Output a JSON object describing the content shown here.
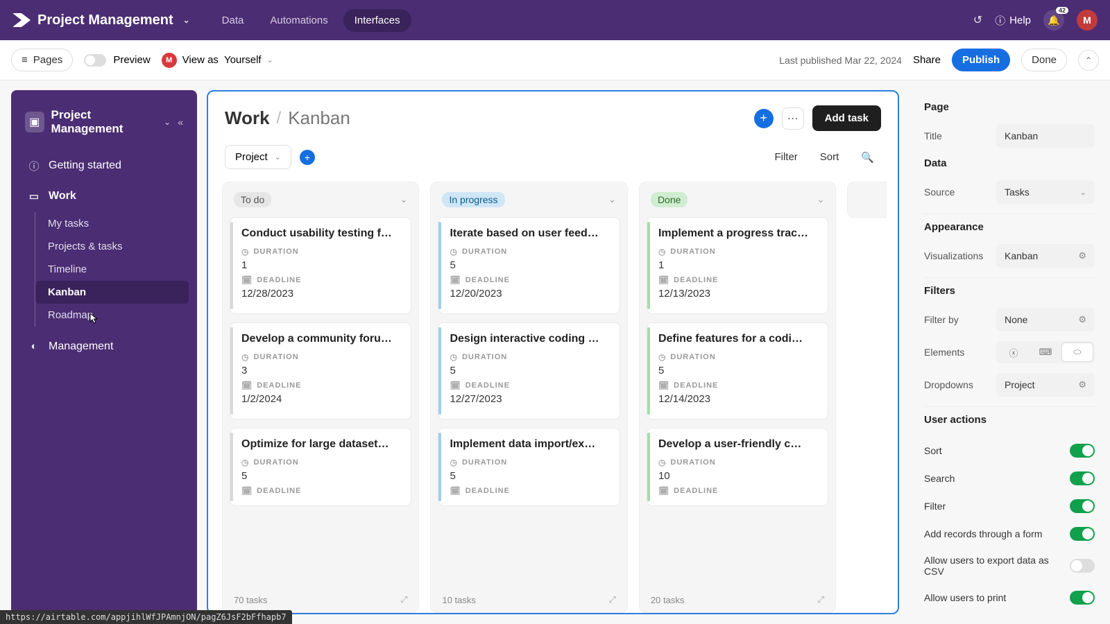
{
  "topbar": {
    "app_name": "Project Management",
    "tabs": [
      "Data",
      "Automations",
      "Interfaces"
    ],
    "active_tab": 2,
    "help_label": "Help",
    "notif_count": "42",
    "avatar_initial": "M"
  },
  "secondbar": {
    "pages_label": "Pages",
    "preview_label": "Preview",
    "viewas_prefix": "View as",
    "viewas_name": "Yourself",
    "viewas_initial": "M",
    "last_published": "Last published Mar 22, 2024",
    "share": "Share",
    "publish": "Publish",
    "done": "Done"
  },
  "sidebar": {
    "title": "Project Management",
    "items": [
      {
        "icon": "ⓘ",
        "label": "Getting started",
        "bold": false
      },
      {
        "icon": "▭",
        "label": "Work",
        "bold": true
      }
    ],
    "subs": [
      "My tasks",
      "Projects & tasks",
      "Timeline",
      "Kanban",
      "Roadmap"
    ],
    "active_sub": 3,
    "bottom": {
      "icon": "◐",
      "label": "Management"
    }
  },
  "center": {
    "crumb": "Work",
    "page": "Kanban",
    "add_task": "Add task",
    "project_dropdown": "Project",
    "filter": "Filter",
    "sort": "Sort"
  },
  "board": {
    "columns": [
      {
        "name": "To do",
        "chip": "grey",
        "stripe": "#d9d9d9",
        "cards": [
          {
            "title": "Conduct usability testing f…",
            "duration": "1",
            "deadline": "12/28/2023"
          },
          {
            "title": "Develop a community foru…",
            "duration": "3",
            "deadline": "1/2/2024"
          },
          {
            "title": "Optimize for large dataset…",
            "duration": "5",
            "deadline": ""
          }
        ],
        "footer": "70 tasks"
      },
      {
        "name": "In progress",
        "chip": "blue",
        "stripe": "#9ecff0",
        "cards": [
          {
            "title": "Iterate based on user feed…",
            "duration": "5",
            "deadline": "12/20/2023"
          },
          {
            "title": "Design interactive coding …",
            "duration": "5",
            "deadline": "12/27/2023"
          },
          {
            "title": "Implement data import/ex…",
            "duration": "5",
            "deadline": ""
          }
        ],
        "footer": "10 tasks"
      },
      {
        "name": "Done",
        "chip": "green",
        "stripe": "#a9dcab",
        "cards": [
          {
            "title": "Implement a progress trac…",
            "duration": "1",
            "deadline": "12/13/2023"
          },
          {
            "title": "Define features for a codi…",
            "duration": "5",
            "deadline": "12/14/2023"
          },
          {
            "title": "Develop a user-friendly c…",
            "duration": "10",
            "deadline": ""
          }
        ],
        "footer": "20 tasks"
      }
    ],
    "duration_label": "DURATION",
    "deadline_label": "DEADLINE"
  },
  "rightpanel": {
    "sections": {
      "page": "Page",
      "data": "Data",
      "appearance": "Appearance",
      "filters": "Filters",
      "user_actions": "User actions"
    },
    "title_label": "Title",
    "title_value": "Kanban",
    "source_label": "Source",
    "source_value": "Tasks",
    "viz_label": "Visualizations",
    "viz_value": "Kanban",
    "filterby_label": "Filter by",
    "filterby_value": "None",
    "elements_label": "Elements",
    "dropdowns_label": "Dropdowns",
    "dropdowns_value": "Project",
    "actions": [
      {
        "label": "Sort",
        "on": true
      },
      {
        "label": "Search",
        "on": true
      },
      {
        "label": "Filter",
        "on": true
      },
      {
        "label": "Add records through a form",
        "on": true
      },
      {
        "label": "Allow users to export data as CSV",
        "on": false
      },
      {
        "label": "Allow users to print",
        "on": true
      }
    ]
  },
  "statusbar": "https://airtable.com/appjihlWfJPAmnjON/pagZ6JsF2bFfhapb7"
}
